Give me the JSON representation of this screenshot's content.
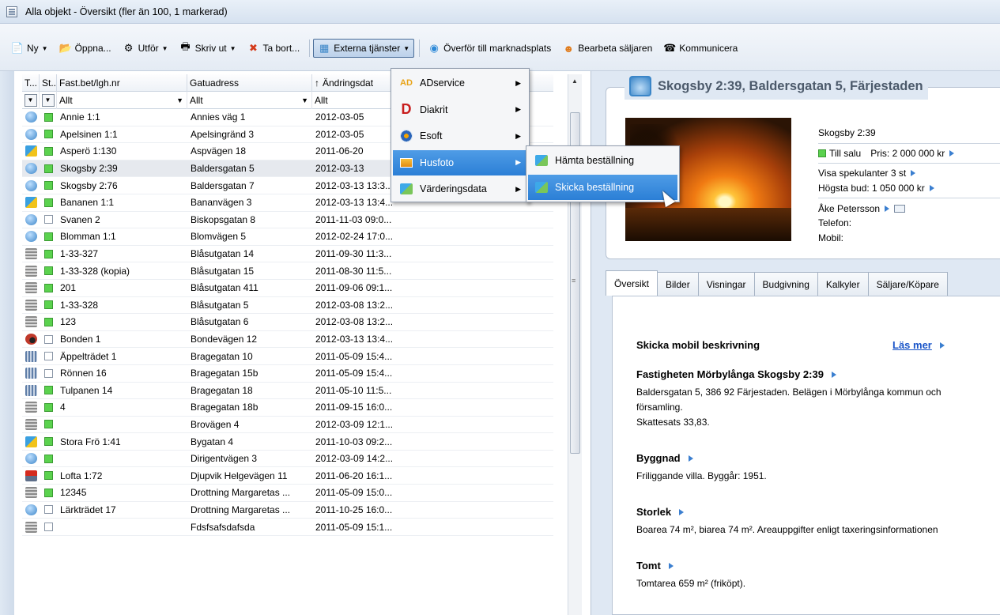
{
  "window": {
    "title": "Alla objekt - Översikt (fler än 100, 1 markerad)"
  },
  "toolbar": {
    "buttons": [
      {
        "label": "Ny",
        "icon": "new-doc-icon",
        "dropdown": true
      },
      {
        "label": "Öppna...",
        "icon": "folder-open-icon",
        "dropdown": false
      },
      {
        "label": "Utför",
        "icon": "gears-icon",
        "dropdown": true
      },
      {
        "label": "Skriv ut",
        "icon": "printer-icon",
        "dropdown": true
      },
      {
        "label": "Ta bort...",
        "icon": "delete-x-icon",
        "dropdown": false
      },
      {
        "label": "Externa tjänster",
        "icon": "external-services-icon",
        "dropdown": true
      },
      {
        "label": "Överför till marknadsplats",
        "icon": "globe-transfer-icon",
        "dropdown": false
      },
      {
        "label": "Bearbeta säljaren",
        "icon": "person-icon",
        "dropdown": false
      },
      {
        "label": "Kommunicera",
        "icon": "communicate-icon",
        "dropdown": false
      }
    ]
  },
  "grid": {
    "headers": [
      "T...",
      "St...",
      "Fast.bet/lgh.nr",
      "Gatuadress",
      "Ändringsdat"
    ],
    "sort_indicator": "↑",
    "filters": [
      "Allt",
      "Allt",
      "Allt"
    ],
    "rows": [
      {
        "type": "house",
        "status": "green",
        "fast": "Annie 1:1",
        "gata": "Annies väg 1",
        "datum": "2012-03-05"
      },
      {
        "type": "house",
        "status": "green",
        "fast": "Apelsinen 1:1",
        "gata": "Apelsingränd 3",
        "datum": "2012-03-05"
      },
      {
        "type": "field",
        "status": "green",
        "fast": "Asperö 1:130",
        "gata": "Aspvägen 18",
        "datum": "2011-06-20"
      },
      {
        "type": "house",
        "status": "green",
        "fast": "Skogsby 2:39",
        "gata": "Baldersgatan 5",
        "datum": "2012-03-13",
        "selected": true
      },
      {
        "type": "house",
        "status": "green",
        "fast": "Skogsby 2:76",
        "gata": "Baldersgatan 7",
        "datum": "2012-03-13 13:3..."
      },
      {
        "type": "field",
        "status": "green",
        "fast": "Bananen 1:1",
        "gata": "Bananvägen 3",
        "datum": "2012-03-13 13:4..."
      },
      {
        "type": "house",
        "status": "white",
        "fast": "Svanen 2",
        "gata": "Biskopsgatan 8",
        "datum": "2011-11-03 09:0..."
      },
      {
        "type": "house",
        "status": "green",
        "fast": "Blomman 1:1",
        "gata": "Blomvägen 5",
        "datum": "2012-02-24 17:0..."
      },
      {
        "type": "apt",
        "status": "green",
        "fast": "1-33-327",
        "gata": "Blåsutgatan 14",
        "datum": "2011-09-30 11:3..."
      },
      {
        "type": "apt",
        "status": "green",
        "fast": "1-33-328 (kopia)",
        "gata": "Blåsutgatan 15",
        "datum": "2011-08-30 11:5..."
      },
      {
        "type": "apt",
        "status": "green",
        "fast": "201",
        "gata": "Blåsutgatan 411",
        "datum": "2011-09-06 09:1..."
      },
      {
        "type": "apt",
        "status": "green",
        "fast": "1-33-328",
        "gata": "Blåsutgatan 5",
        "datum": "2012-03-08 13:2..."
      },
      {
        "type": "apt",
        "status": "green",
        "fast": "123",
        "gata": "Blåsutgatan 6",
        "datum": "2012-03-08 13:2..."
      },
      {
        "type": "farm",
        "status": "white",
        "fast": "Bonden 1",
        "gata": "Bondevägen 12",
        "datum": "2012-03-13 13:4..."
      },
      {
        "type": "tall",
        "status": "white",
        "fast": "Äppelträdet 1",
        "gata": "Bragegatan 10",
        "datum": "2011-05-09 15:4..."
      },
      {
        "type": "tall",
        "status": "white",
        "fast": "Rönnen 16",
        "gata": "Bragegatan 15b",
        "datum": "2011-05-09 15:4..."
      },
      {
        "type": "tall",
        "status": "green",
        "fast": "Tulpanen 14",
        "gata": "Bragegatan 18",
        "datum": "2011-05-10 11:5..."
      },
      {
        "type": "apt",
        "status": "green",
        "fast": "4",
        "gata": "Bragegatan 18b",
        "datum": "2011-09-15 16:0..."
      },
      {
        "type": "apt",
        "status": "green",
        "fast": "",
        "gata": "Brovägen 4",
        "datum": "2012-03-09 12:1..."
      },
      {
        "type": "field",
        "status": "green",
        "fast": "Stora Frö 1:41",
        "gata": "Bygatan 4",
        "datum": "2011-10-03 09:2..."
      },
      {
        "type": "house",
        "status": "green",
        "fast": "",
        "gata": "Dirigentvägen 3",
        "datum": "2012-03-09 14:2..."
      },
      {
        "type": "red",
        "status": "green",
        "fast": "Lofta 1:72",
        "gata": "Djupvik Helgevägen 11",
        "datum": "2011-06-20 16:1..."
      },
      {
        "type": "apt",
        "status": "green",
        "fast": "12345",
        "gata": "Drottning Margaretas ...",
        "datum": "2011-05-09 15:0..."
      },
      {
        "type": "house",
        "status": "white",
        "fast": "Lärkträdet 17",
        "gata": "Drottning Margaretas ...",
        "datum": "2011-10-25 16:0..."
      },
      {
        "type": "apt",
        "status": "white",
        "fast": "",
        "gata": "Fdsfsafsdafsda",
        "datum": "2011-05-09 15:1..."
      }
    ]
  },
  "menu_external": {
    "items": [
      {
        "label": "ADservice",
        "icon": "adservice-icon"
      },
      {
        "label": "Diakrit",
        "icon": "diakrit-icon"
      },
      {
        "label": "Esoft",
        "icon": "esoft-icon"
      },
      {
        "label": "Husfoto",
        "icon": "husfoto-icon"
      },
      {
        "label": "Värderingsdata",
        "icon": "varderingsdata-icon"
      }
    ]
  },
  "menu_husfoto": {
    "items": [
      {
        "label": "Hämta beställning",
        "icon": "fetch-order-icon"
      },
      {
        "label": "Skicka beställning",
        "icon": "send-order-icon"
      }
    ]
  },
  "detail": {
    "title": "Skogsby 2:39, Baldersgatan 5, Färjestaden",
    "name": "Skogsby 2:39",
    "status": "Till salu",
    "price": "Pris: 2 000 000 kr",
    "spekulanter": "Visa spekulanter  3 st",
    "bud": "Högsta bud: 1 050 000 kr",
    "agent": "Åke Petersson",
    "telefon": "Telefon:",
    "mobil": "Mobil:"
  },
  "tabs": [
    "Översikt",
    "Bilder",
    "Visningar",
    "Budgivning",
    "Kalkyler",
    "Säljare/Köpare"
  ],
  "overview": {
    "heading": "Skicka mobil beskrivning",
    "read_more": "Läs mer",
    "sections": [
      {
        "title": "Fastigheten Mörbylånga Skogsby 2:39",
        "lines": [
          "Baldersgatan 5, 386 92 Färjestaden. Belägen i Mörbylånga kommun och",
          "församling.",
          "Skattesats 33,83."
        ]
      },
      {
        "title": "Byggnad",
        "lines": [
          "Friliggande villa. Byggår: 1951."
        ]
      },
      {
        "title": "Storlek",
        "lines": [
          "Boarea 74 m², biarea 74 m². Areauppgifter enligt taxeringsinformationen"
        ]
      },
      {
        "title": "Tomt",
        "lines": [
          "Tomtarea 659 m² (friköpt)."
        ]
      }
    ]
  },
  "colors": {
    "accent": "#2b7fd6",
    "status_green": "#5bd24e",
    "link": "#1a55c8"
  }
}
